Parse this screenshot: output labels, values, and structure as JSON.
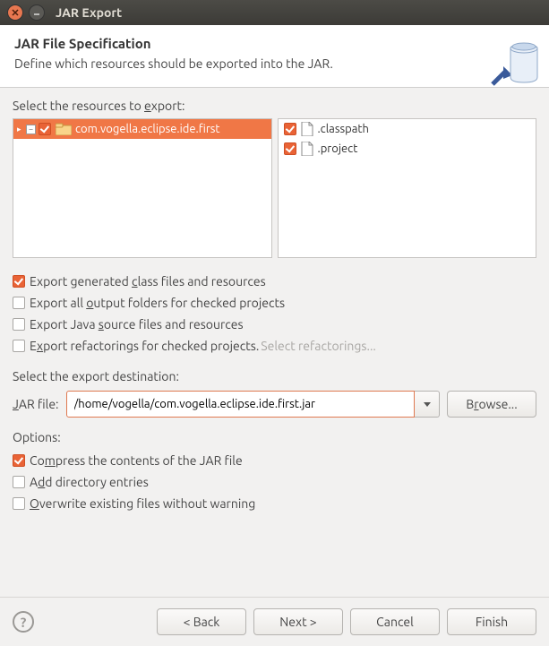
{
  "window": {
    "title": "JAR Export"
  },
  "header": {
    "title": "JAR File Specification",
    "subtitle": "Define which resources should be exported into the JAR."
  },
  "resources": {
    "label_pre": "Select the resources to ",
    "label_u": "e",
    "label_post": "xport:",
    "tree": [
      {
        "name": "com.vogella.eclipse.ide.first",
        "selected": true,
        "checked": true
      }
    ],
    "files": [
      {
        "name": ".classpath",
        "checked": true
      },
      {
        "name": ".project",
        "checked": true
      }
    ]
  },
  "export_options": [
    {
      "checked": true,
      "pre": "Export generated ",
      "u": "c",
      "post": "lass files and resources"
    },
    {
      "checked": false,
      "pre": "Export all ",
      "u": "o",
      "post": "utput folders for checked projects"
    },
    {
      "checked": false,
      "pre": "Export Java ",
      "u": "s",
      "post": "ource files and resources"
    },
    {
      "checked": false,
      "pre": "E",
      "u": "x",
      "post": "port refactorings for checked projects.",
      "link": "Select refactorings..."
    }
  ],
  "destination": {
    "label": "Select the export destination:",
    "field_pre": "",
    "field_u": "J",
    "field_post": "AR file:",
    "value": "/home/vogella/com.vogella.eclipse.ide.first.jar",
    "browse_pre": "B",
    "browse_u": "r",
    "browse_post": "owse..."
  },
  "options_label": "Options:",
  "options": [
    {
      "checked": true,
      "pre": "Co",
      "u": "m",
      "post": "press the contents of the JAR file"
    },
    {
      "checked": false,
      "pre": "A",
      "u": "d",
      "post": "d directory entries"
    },
    {
      "checked": false,
      "pre": "",
      "u": "O",
      "post": "verwrite existing files without warning"
    }
  ],
  "footer": {
    "back": "< Back",
    "next": "Next >",
    "cancel": "Cancel",
    "finish": "Finish"
  }
}
